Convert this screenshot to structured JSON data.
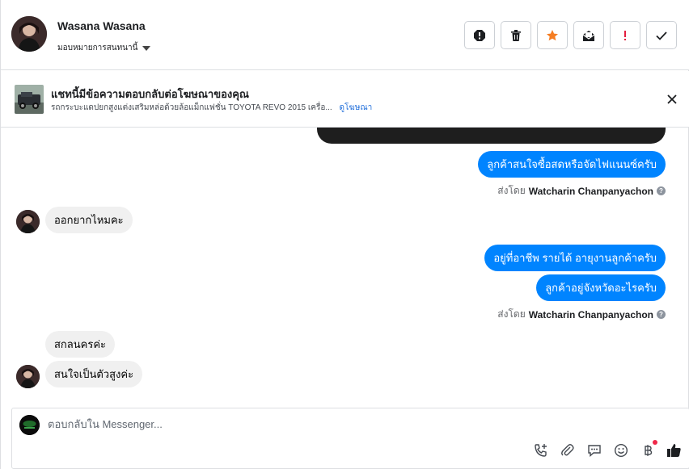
{
  "header": {
    "contact_name": "Wasana Wasana",
    "assign_label": "มอบหมายการสนทนานี้"
  },
  "ad_banner": {
    "title": "แชทนี้มีข้อความตอบกลับต่อโฆษณาของคุณ",
    "subtitle": "รถกระบะแดปยกสูงแต่งเสริมหล่อด้วยล้อแม็กแฟชั่น TOYOTA REVO 2015 เครื่อ...",
    "link_label": "ดูโฆษณา"
  },
  "messages": {
    "out_1": "ลูกค้าสนใจซื้อสดหรือจัดไฟแนนซ์ครับ",
    "sent_by_1_prefix": "ส่งโดย",
    "sent_by_1_name": "Watcharin Chanpanyachon",
    "in_1": "ออกยากไหมคะ",
    "out_2": "อยู่ที่อาชีพ รายได้ อายุงานลูกค้าครับ",
    "out_3": "ลูกค้าอยู่จังหวัดอะไรครับ",
    "sent_by_2_prefix": "ส่งโดย",
    "sent_by_2_name": "Watcharin Chanpanyachon",
    "in_2": "สกลนครค่ะ",
    "in_3": "สนใจเป็นตัวสูงค่ะ",
    "help_glyph": "?"
  },
  "composer": {
    "placeholder": "ตอบกลับใน Messenger..."
  },
  "colors": {
    "accent": "#0084ff",
    "incoming_bubble": "#f0f0f0",
    "star": "#f57d23",
    "alert": "#e41e3f",
    "like": "#1c1e21"
  },
  "icons": {
    "header_actions": [
      "alert-circle-icon",
      "trash-icon",
      "star-icon",
      "mark-unread-icon",
      "exclamation-icon",
      "check-icon"
    ],
    "composer_tools": [
      "phone-plus-icon",
      "paperclip-icon",
      "chat-bubble-icon",
      "emoji-icon",
      "baht-icon",
      "thumbs-up-icon"
    ]
  }
}
